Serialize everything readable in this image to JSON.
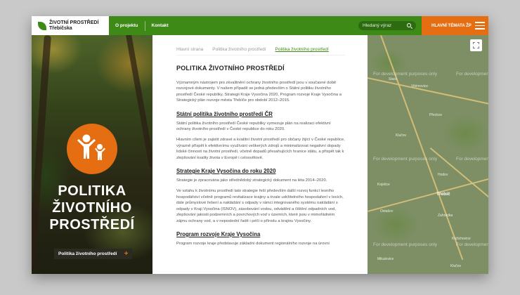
{
  "header": {
    "logo_line1": "ŽIVOTNÍ PROSTŘEDÍ",
    "logo_line2": "Třebíčska",
    "nav": [
      "O projektu",
      "Kontakt"
    ],
    "search_placeholder": "Hledaný výraz",
    "hot_topics": "HLAVNÍ TÉMATA ŽP"
  },
  "hero": {
    "title_lines": [
      "POLITIKA",
      "ŽIVOTNÍHO",
      "PROSTŘEDÍ"
    ],
    "tag": "Politika životního prostředí",
    "accent": "#e56e12"
  },
  "breadcrumb": [
    "Hlavní strana",
    "Politika životního prostředí",
    "Politika životního prostředí"
  ],
  "content": {
    "title": "POLITIKA ŽIVOTNÍHO PROSTŘEDÍ",
    "intro": "Významným nástrojem pro zkvalitnění ochrany životního prostředí jsou v současné době rozvojové dokumenty. V našem případě se jedná především o Státní politiku životního prostředí České republiky, Strategii Kraje Vysočina 2020, Program rozvoje Kraje Vysočina a Strategický plán rozvoje města Třebíče pro období 2012–2015.",
    "sections": [
      {
        "heading": "Státní politika životního prostředí ČR",
        "paragraphs": [
          "Státní politika životního prostředí České republiky vymezuje plán na realizaci efektivní ochrany životního prostředí v České republice do roku 2020.",
          "Hlavním cílem je zajistit zdravé a kvalitní životní prostředí pro občany žijící v České republice, výrazně přispět k efektivnímu využívání veškerých zdrojů a minimalizovat negativní dopady lidské činnosti na životní prostředí, včetně dopadů přesahujících hranice státu, a přispět tak k zlepšování kvality života v Evropě i celosvětově."
        ]
      },
      {
        "heading": "Strategie Kraje Vysočina do roku 2020",
        "paragraphs": [
          "Strategie je zpracována jako střednědobý strategický dokument na léta 2014–2020.",
          "Ve vztahu k životnímu prostředí tato strategie řeší především další rozvoj funkcí lesního hospodářství včetně programů revitalizace krajiny a trvale udržitelného hospodaření v lesích, dále průmyslové řešení a nakládání s odpady v rámci integrovaného systému nakládání s odpady v Kraji Vysočina (ISNOV), zásobování vodou, odvádění a čištění odpadních vod, zlepšování jakosti podzemních a povrchových vod v územích, které jsou v mimořádném zájmu ochrany vod, a v neposlední řadě i péči o přírodu a krajinu Vysočiny."
        ]
      },
      {
        "heading": "Program rozvoje Kraje Vysočina",
        "paragraphs": [
          "Program rozvoje kraje představuje základní dokument regionálního rozvoje na úrovni"
        ]
      }
    ]
  },
  "map": {
    "watermark": "For development purposes only",
    "towns": [
      "Třebíč"
    ],
    "villages": [
      "Stará",
      "Vilémovice",
      "Přeckov",
      "Klučov",
      "Hodov",
      "Kojetice",
      "Kožichovice",
      "Mikulovice",
      "Klučov",
      "Zahrádka",
      "Ostašov"
    ]
  },
  "colors": {
    "green": "#3e8a17",
    "orange": "#e56e12"
  }
}
